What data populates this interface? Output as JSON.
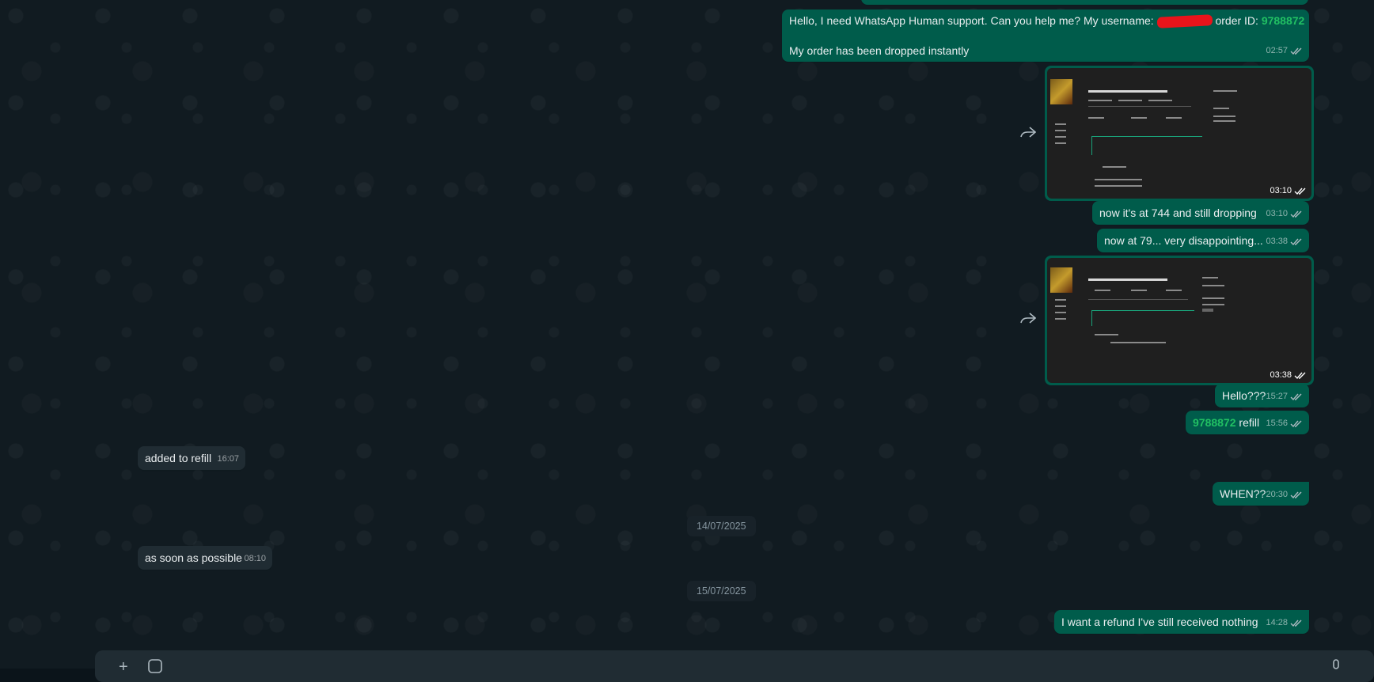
{
  "messages": [
    {
      "id": "m1",
      "dir": "out",
      "parts": [
        "Hello, I need WhatsApp Human support. Can you help me? My username: ",
        "order ID: ",
        "9788872"
      ],
      "line2": "My order has been dropped instantly",
      "time": "02:57"
    },
    {
      "id": "m2",
      "dir": "out",
      "type": "image",
      "time": "03:10"
    },
    {
      "id": "m3",
      "dir": "out",
      "text": "now it's at 744 and still dropping",
      "time": "03:10"
    },
    {
      "id": "m4",
      "dir": "out",
      "text": "now at 79... very disappointing...",
      "time": "03:38"
    },
    {
      "id": "m5",
      "dir": "out",
      "type": "image",
      "time": "03:38"
    },
    {
      "id": "m6",
      "dir": "out",
      "text": "Hello???",
      "time": "15:27"
    },
    {
      "id": "m7",
      "dir": "out",
      "highlight": "9788872",
      "text": " refill",
      "time": "15:56"
    },
    {
      "id": "m8",
      "dir": "in",
      "text": "added to refill",
      "time": "16:07"
    },
    {
      "id": "m9",
      "dir": "out",
      "text": "WHEN??",
      "time": "20:30"
    },
    {
      "id": "m10",
      "dir": "in",
      "text": "as soon as possible",
      "time": "08:10"
    },
    {
      "id": "m11",
      "dir": "out",
      "text": "I want a refund I've still received nothing",
      "time": "14:28"
    }
  ],
  "dates": {
    "d1": "14/07/2025",
    "d2": "15/07/2025"
  },
  "colors": {
    "outgoing": "#005c4b",
    "incoming": "#202c33",
    "highlight": "#21c063",
    "background": "#111b21"
  }
}
